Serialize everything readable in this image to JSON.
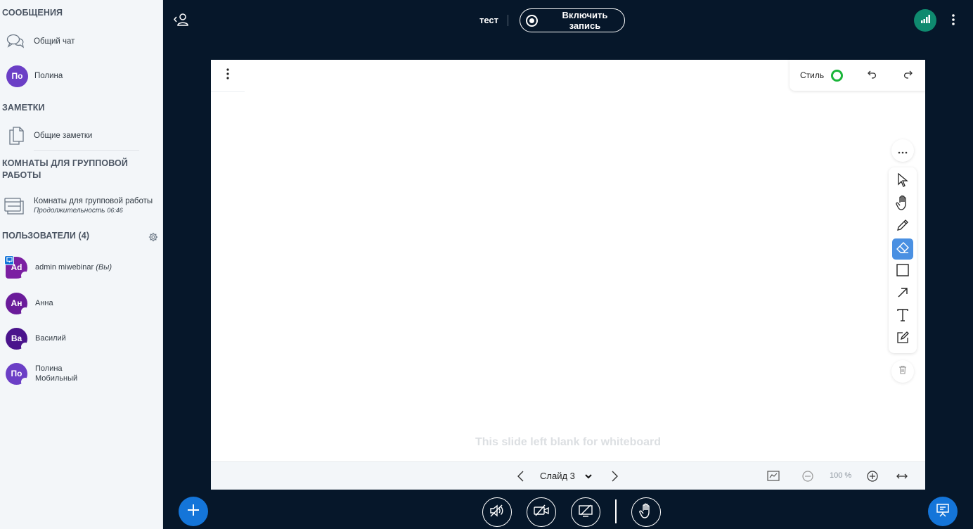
{
  "sidebar": {
    "messages_title": "СООБЩЕНИЯ",
    "public_chat": "Общий чат",
    "private_chat": {
      "initials": "По",
      "name": "Полина",
      "color": "#6b3fc6"
    },
    "notes_title": "ЗАМЕТКИ",
    "shared_notes": "Общие заметки",
    "breakout_title_line1": "КОМНАТЫ ДЛЯ ГРУППОВОЙ",
    "breakout_title_line2": "РАБОТЫ",
    "breakout_label": "Комнаты для групповой работы",
    "breakout_duration_label": "Продолжительность",
    "breakout_duration_value": "06:46",
    "users_title": "ПОЛЬЗОВАТЕЛИ (4)",
    "users": [
      {
        "initials": "Ad",
        "name": "admin miwebinar",
        "suffix": "(Вы)",
        "color": "#7b1fa2"
      },
      {
        "initials": "Ан",
        "name": "Анна",
        "color": "#6a1b9a"
      },
      {
        "initials": "Ва",
        "name": "Василий",
        "color": "#4a148c"
      },
      {
        "initials": "По",
        "name": "Полина",
        "sub": "Мобильный",
        "color": "#6b3fc6"
      }
    ]
  },
  "topbar": {
    "meeting_title": "тест",
    "record_label": "Включить запись"
  },
  "whiteboard": {
    "style_label": "Стиль",
    "style_color": "#1bb53a",
    "blank_message": "This slide left blank for whiteboard",
    "slide_label": "Слайд 3",
    "zoom_label": "100 %",
    "active_tool": "eraser"
  },
  "colors": {
    "background": "#06172a",
    "accent": "#1475d9",
    "tool_active": "#4a90e2",
    "connection": "#0f8a6f"
  }
}
